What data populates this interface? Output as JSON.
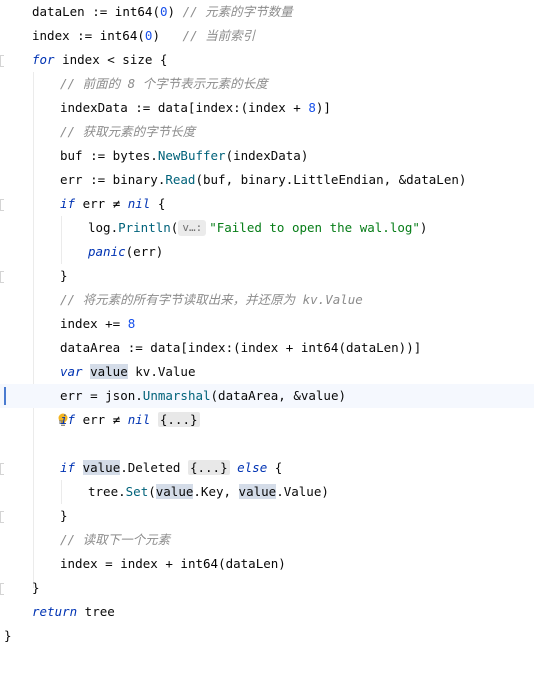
{
  "code": {
    "l1": {
      "a": "dataLen := ",
      "b": "int64",
      "c": "(",
      "d": "0",
      "e": ") ",
      "f": "// 元素的字节数量"
    },
    "l2": {
      "a": "index := ",
      "b": "int64",
      "c": "(",
      "d": "0",
      "e": ")   ",
      "f": "// 当前索引"
    },
    "l3": {
      "kw": "for",
      "a": " index < size {"
    },
    "l4": {
      "c": "// 前面的 8 个字节表示元素的长度"
    },
    "l5": {
      "a": "indexData := data[index:(index + ",
      "n": "8",
      "b": ")]"
    },
    "l6": {
      "c": "// 获取元素的字节长度"
    },
    "l7": {
      "a": "buf := bytes.",
      "fn": "NewBuffer",
      "b": "(indexData)"
    },
    "l8": {
      "a": "err := binary.",
      "fn": "Read",
      "b": "(buf, binary.LittleEndian, &dataLen)"
    },
    "l9": {
      "kw": "if",
      "a": " err ",
      "op": "≠",
      "kw2": " nil",
      "b": " {"
    },
    "l10": {
      "a": "log.",
      "fn": "Println",
      "b": "(",
      "hint": "v…:",
      "str": "\"Failed to open the wal.log\"",
      "c": ")"
    },
    "l11": {
      "fn": "panic",
      "a": "(err)"
    },
    "l12": {
      "a": "}"
    },
    "l13": {
      "c": "// 将元素的所有字节读取出来，并还原为 kv.Value"
    },
    "l14": {
      "a": "index += ",
      "n": "8"
    },
    "l15": {
      "a": "dataArea := data[index:(index + ",
      "b": "int64",
      "c": "(dataLen))]"
    },
    "l16": {
      "kw": "var",
      "hl": "value",
      "a": " kv.Value"
    },
    "l17": {
      "a": "err = json.",
      "fn": "Unmarshal",
      "b": "(dataArea, &value)"
    },
    "l18": {
      "kw": "if",
      "a": " err ",
      "op": "≠",
      "kw2": " nil",
      "chip": "{...}"
    },
    "l19": {},
    "l20": {
      "kw": "if",
      "hl": "value",
      "a": ".Deleted ",
      "chip": "{...}",
      "kw2": " else",
      "b": " {"
    },
    "l21": {
      "a": "tree.",
      "fn": "Set",
      "b": "(",
      "hl1": "value",
      "c": ".Key, ",
      "hl2": "value",
      "d": ".Value)"
    },
    "l22": {
      "a": "}"
    },
    "l23": {
      "c": "// 读取下一个元素"
    },
    "l24": {
      "a": "index = index + ",
      "b": "int64",
      "c": "(dataLen)"
    },
    "l25": {
      "a": "}"
    },
    "l26": {
      "kw": "return",
      "a": " tree"
    },
    "l27": {
      "a": "}"
    }
  },
  "icons": {
    "intention": "lightbulb-icon"
  },
  "colors": {
    "keyword": "#0033b3",
    "comment": "#8c8c8c",
    "function": "#00627a",
    "number": "#1750eb",
    "string": "#067d17",
    "highlight": "#d4dce8",
    "caret_line": "#f5f8fe"
  }
}
